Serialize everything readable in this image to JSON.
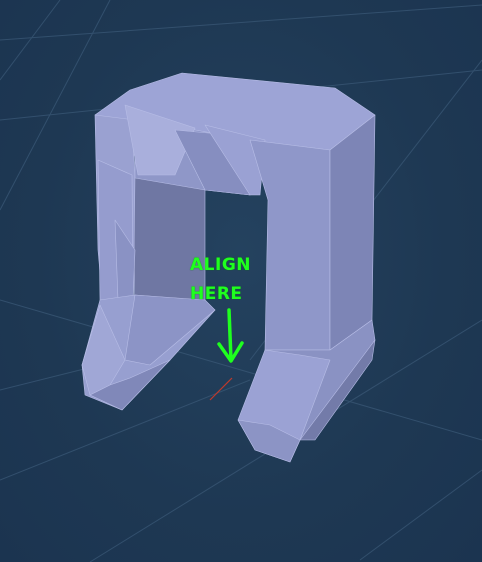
{
  "annotation": {
    "line1": "ALIGN",
    "line2": "HERE"
  },
  "icons": {
    "arrow": "arrow-down-icon",
    "origin": "origin-axis-marker"
  },
  "colors": {
    "background": "#1f3a55",
    "grid_line": "#3a5876",
    "mesh_light": "#a3aad8",
    "mesh_mid": "#8d95c6",
    "mesh_dark": "#757dab",
    "annotation": "#1fff1f",
    "axis_x": "#c0392b"
  }
}
